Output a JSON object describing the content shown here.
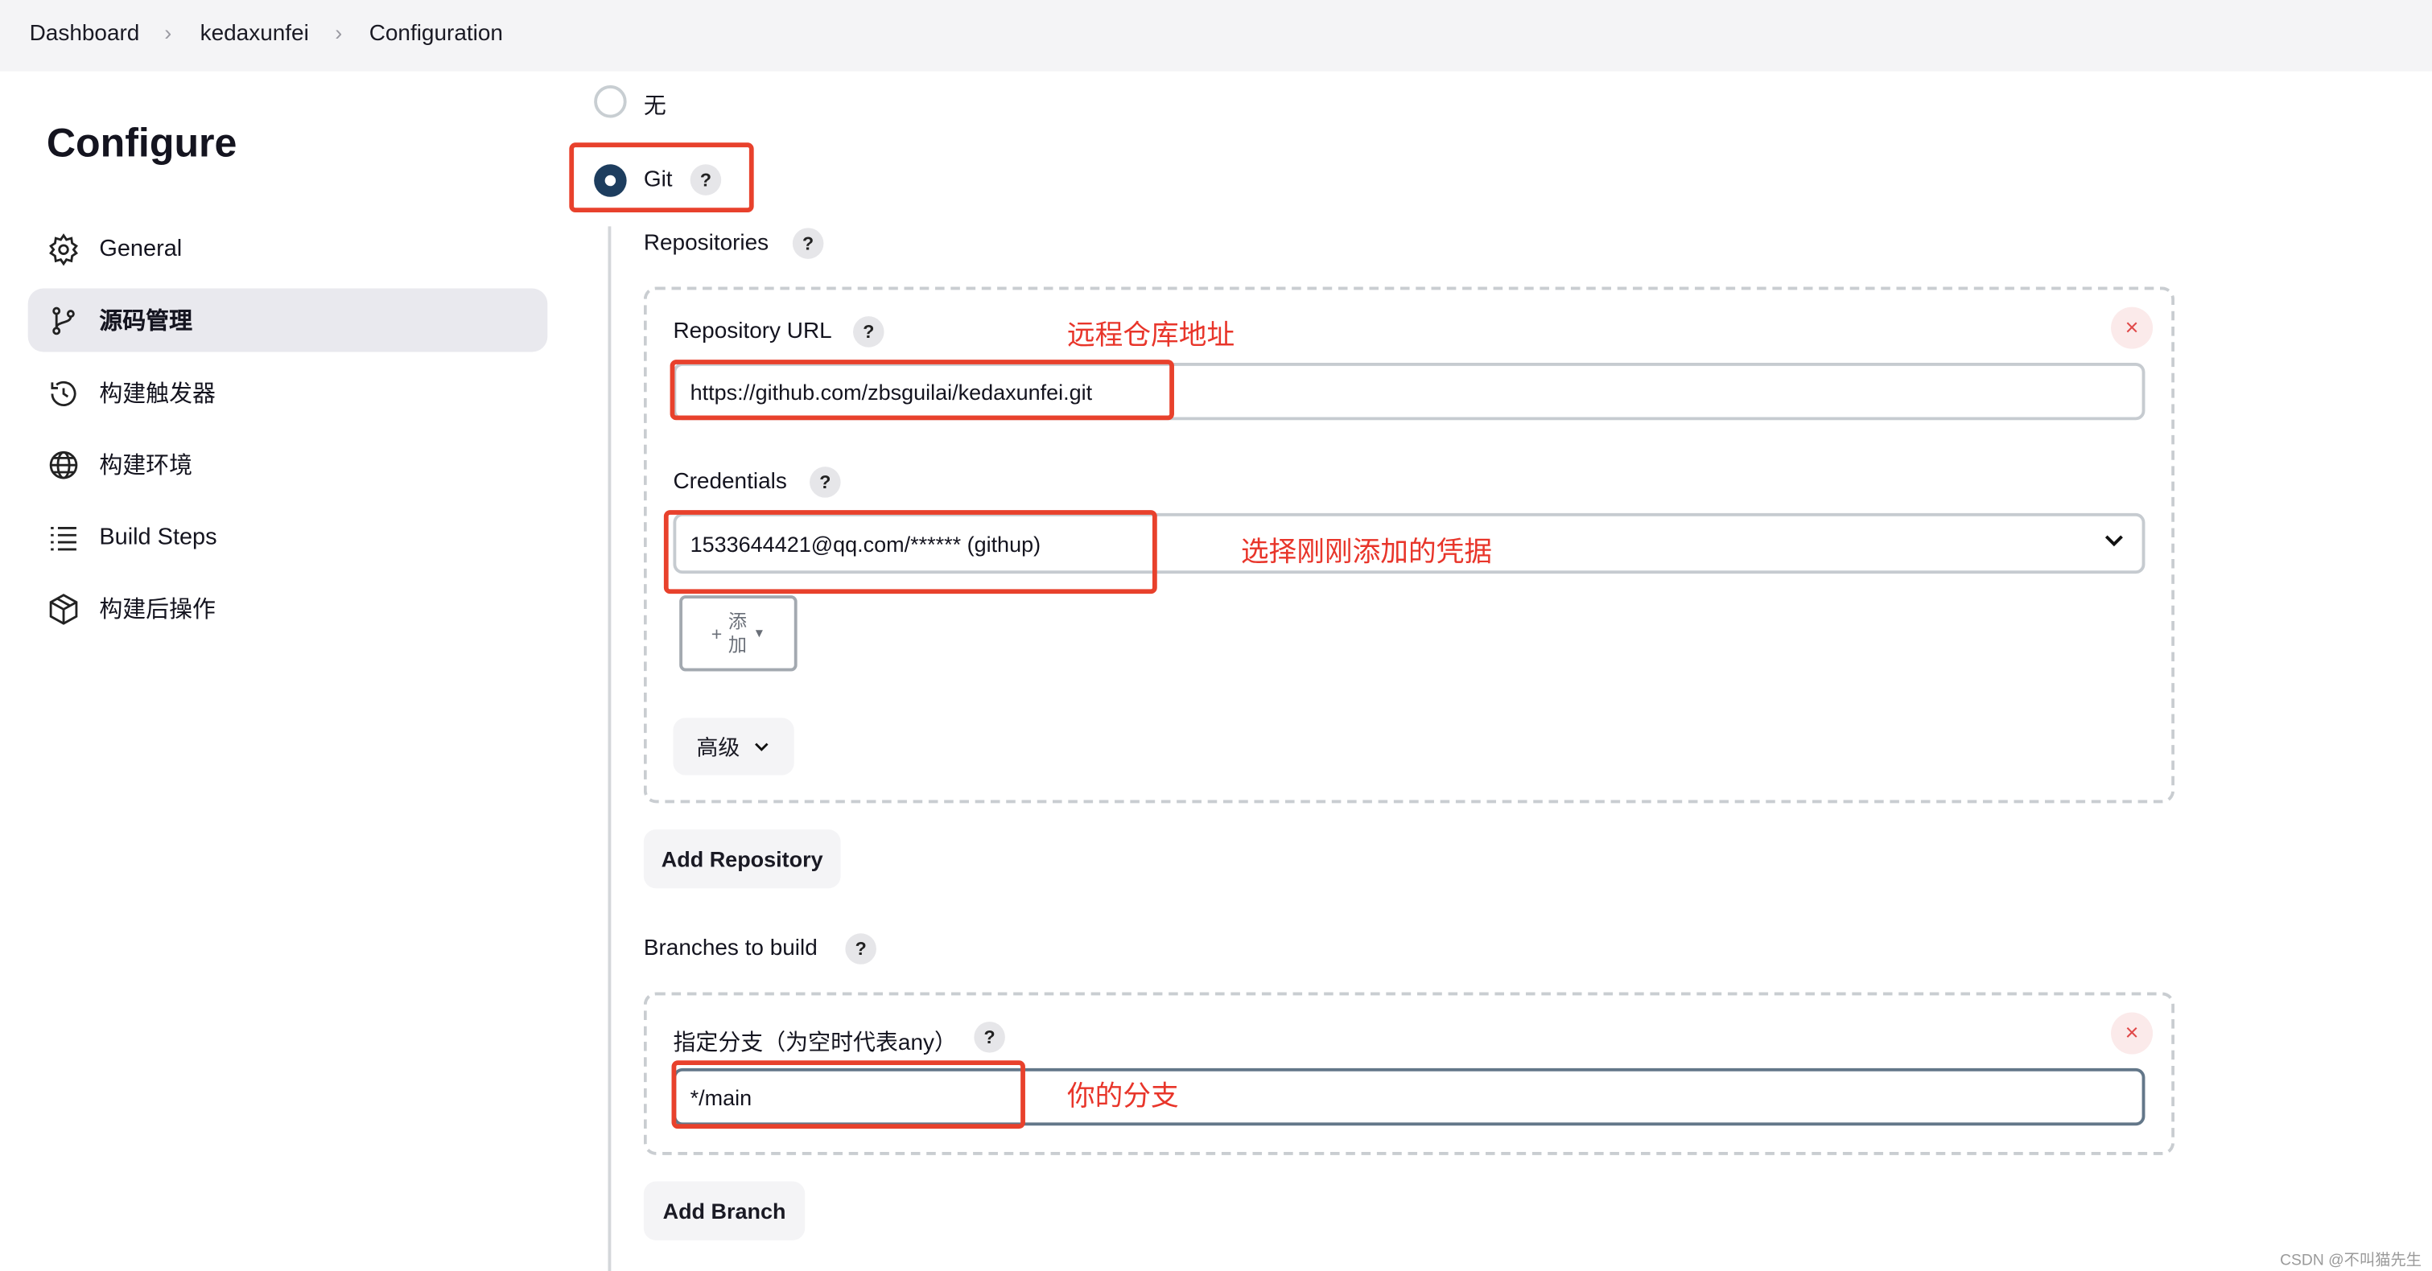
{
  "breadcrumb": [
    "Dashboard",
    "kedaxunfei",
    "Configuration"
  ],
  "page_title": "Configure",
  "sidebar": {
    "items": [
      {
        "label": "General",
        "icon": "gear-icon"
      },
      {
        "label": "源码管理",
        "icon": "branch-icon",
        "active": true
      },
      {
        "label": "构建触发器",
        "icon": "clock-icon"
      },
      {
        "label": "构建环境",
        "icon": "globe-icon"
      },
      {
        "label": "Build Steps",
        "icon": "list-icon"
      },
      {
        "label": "构建后操作",
        "icon": "package-icon"
      }
    ]
  },
  "scm": {
    "options": [
      {
        "label": "无",
        "selected": false
      },
      {
        "label": "Git",
        "selected": true
      }
    ],
    "help": "?",
    "repositories_label": "Repositories",
    "repo_url_label": "Repository URL",
    "repo_url_value": "https://github.com/zbsguilai/kedaxunfei.git",
    "repo_url_annotation": "远程仓库地址",
    "credentials_label": "Credentials",
    "credentials_value": "1533644421@qq.com/****** (githup)",
    "credentials_annotation": "选择刚刚添加的凭据",
    "add_button_label": "添加",
    "advanced_label": "高级",
    "add_repository_label": "Add Repository",
    "branches_label": "Branches to build",
    "branch_specifier_label": "指定分支（为空时代表any）",
    "branch_value": "*/main",
    "branch_annotation": "你的分支",
    "add_branch_label": "Add Branch",
    "close_symbol": "×"
  },
  "watermark": "CSDN @不叫猫先生",
  "colors": {
    "accent": "#1d3d5e",
    "annotation": "#e8352a"
  }
}
